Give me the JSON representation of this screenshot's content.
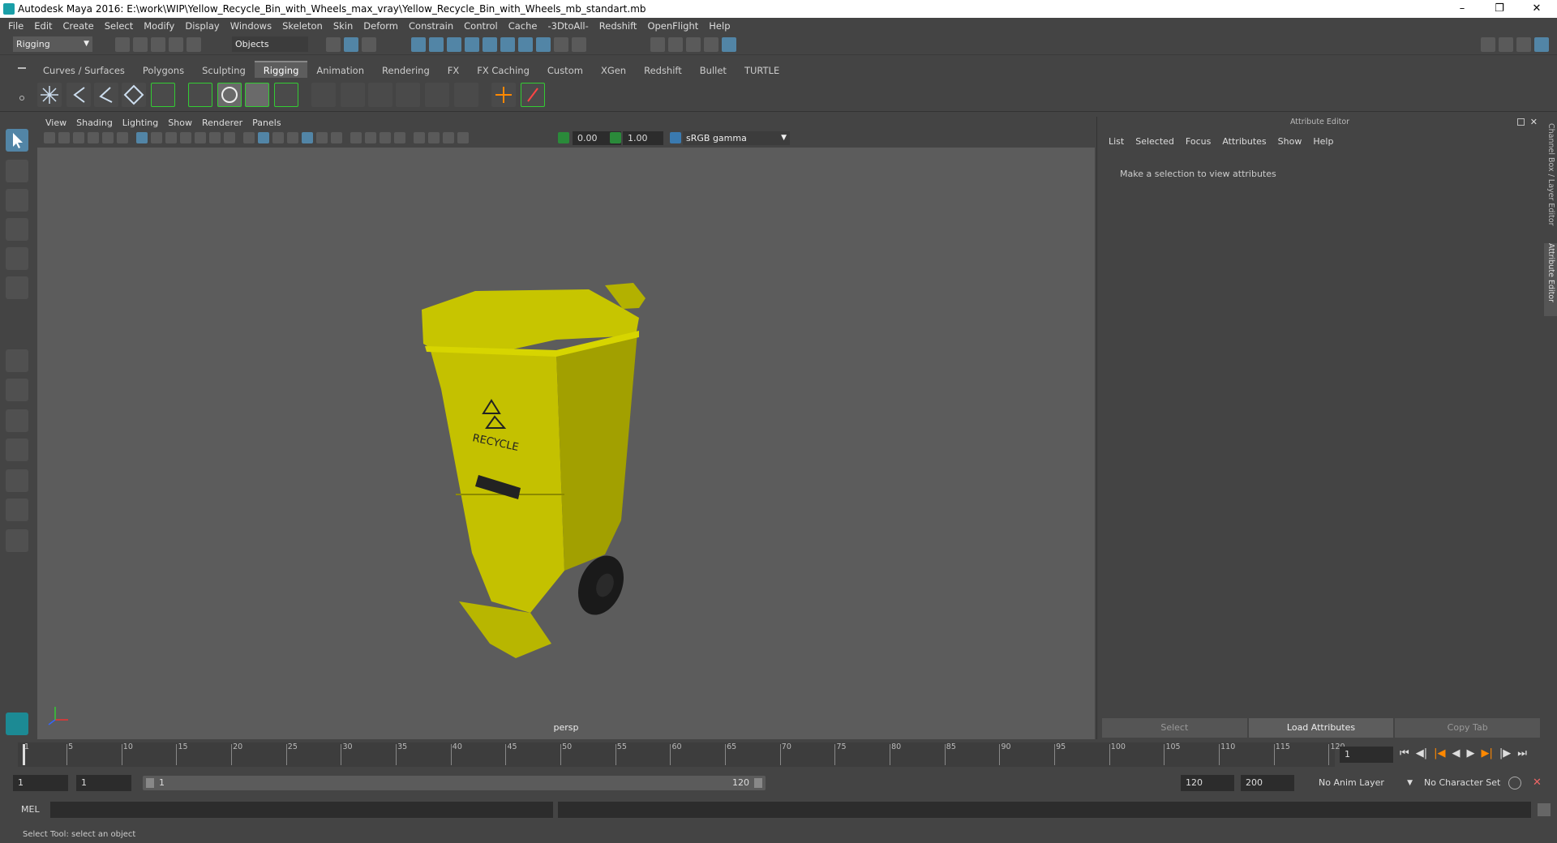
{
  "title": "Autodesk Maya 2016: E:\\work\\WIP\\Yellow_Recycle_Bin_with_Wheels_max_vray\\Yellow_Recycle_Bin_with_Wheels_mb_standart.mb",
  "menu": [
    "File",
    "Edit",
    "Create",
    "Select",
    "Modify",
    "Display",
    "Windows",
    "Skeleton",
    "Skin",
    "Deform",
    "Constrain",
    "Control",
    "Cache",
    "-3DtoAll-",
    "Redshift",
    "OpenFlight",
    "Help"
  ],
  "status": {
    "mode": "Rigging",
    "objects": "Objects"
  },
  "shelf_tabs": [
    "Curves / Surfaces",
    "Polygons",
    "Sculpting",
    "Rigging",
    "Animation",
    "Rendering",
    "FX",
    "FX Caching",
    "Custom",
    "XGen",
    "Redshift",
    "Bullet",
    "TURTLE"
  ],
  "viewport": {
    "menu": [
      "View",
      "Shading",
      "Lighting",
      "Show",
      "Renderer",
      "Panels"
    ],
    "exposure": "0.00",
    "gamma": "1.00",
    "colorspace": "sRGB gamma",
    "camera": "persp",
    "model_label": "RECYCLE",
    "colors": {
      "bin": "#c8c800",
      "wheel": "#1a1a1a"
    }
  },
  "attr": {
    "header": "Attribute Editor",
    "tabs": [
      "List",
      "Selected",
      "Focus",
      "Attributes",
      "Show",
      "Help"
    ],
    "message": "Make a selection to view attributes",
    "buttons": {
      "select": "Select",
      "load": "Load Attributes",
      "copy": "Copy Tab"
    }
  },
  "side_tabs": {
    "channel": "Channel Box / Layer Editor",
    "attribute": "Attribute Editor"
  },
  "timeline": {
    "ticks": [
      "1",
      "5",
      "10",
      "15",
      "20",
      "25",
      "30",
      "35",
      "40",
      "45",
      "50",
      "55",
      "60",
      "65",
      "70",
      "75",
      "80",
      "85",
      "90",
      "95",
      "100",
      "105",
      "110",
      "115",
      "120"
    ],
    "current": "1"
  },
  "range": {
    "start": "1",
    "start2": "1",
    "slider_start": "1",
    "slider_end": "120",
    "end": "120",
    "end2": "200",
    "anim_layer": "No Anim Layer",
    "char_set": "No Character Set"
  },
  "mel_label": "MEL",
  "help_text": "Select Tool: select an object"
}
